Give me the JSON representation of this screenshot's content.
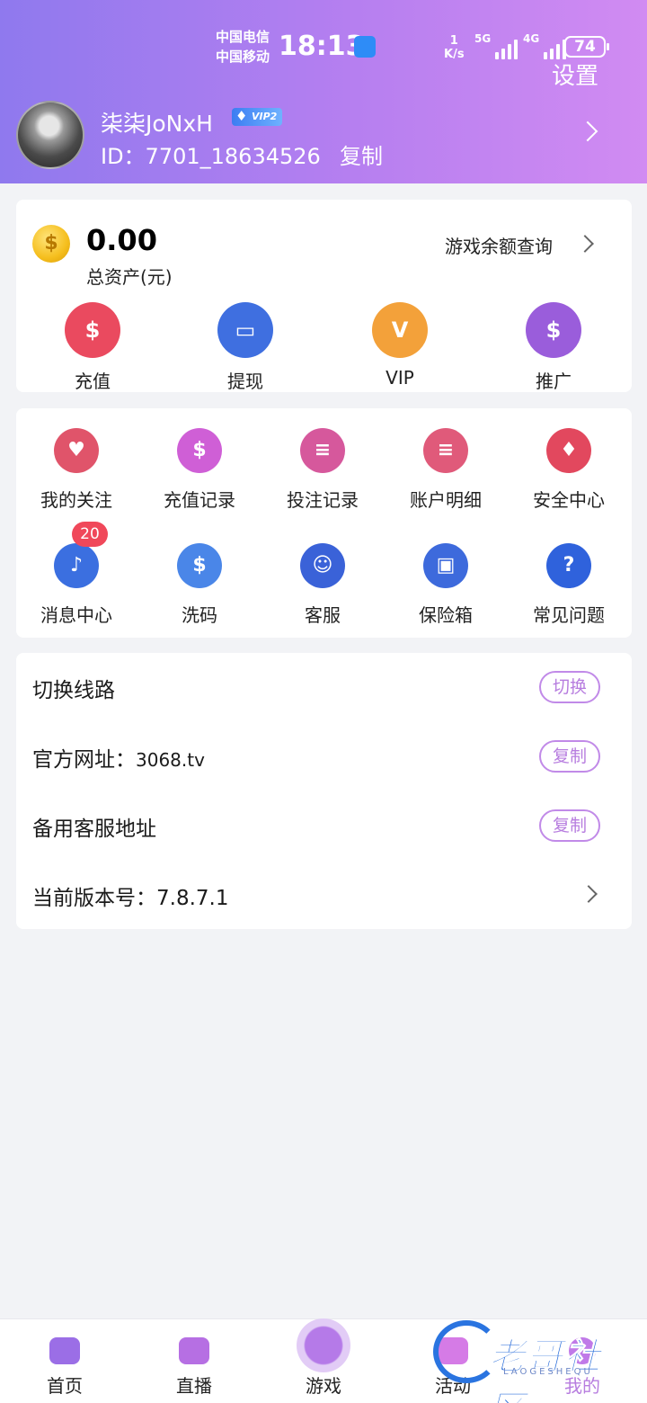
{
  "status_bar": {
    "carrier_1": "中国电信",
    "carrier_2": "中国移动",
    "time": "18:13",
    "speed_value": "1",
    "speed_unit": "K/s",
    "network_1": "5G",
    "network_2": "4G",
    "battery": "74"
  },
  "header": {
    "settings_label": "设置",
    "username": "柒柒JoNxH",
    "vip_level": "VIP2",
    "user_id": "ID：7701_18634526",
    "copy_label": "复制"
  },
  "assets": {
    "balance": "0.00",
    "label": "总资产(元)",
    "query_label": "游戏余额查询",
    "coin_symbol": "$",
    "actions": [
      {
        "label": "充值",
        "icon": "money-bag-icon",
        "glyph": "$",
        "color": "#ea4a5f"
      },
      {
        "label": "提现",
        "icon": "card-icon",
        "glyph": "▭",
        "color": "#3f6fe0"
      },
      {
        "label": "VIP",
        "icon": "vip-diamond-icon",
        "glyph": "V",
        "color": "#f3a13a"
      },
      {
        "label": "推广",
        "icon": "money-bag-plus-icon",
        "glyph": "$",
        "color": "#9a5ddb"
      }
    ]
  },
  "menu": {
    "items": [
      {
        "label": "我的关注",
        "icon": "heart-plus-icon",
        "glyph": "♥",
        "color": "#e0546a"
      },
      {
        "label": "充值记录",
        "icon": "recharge-record-icon",
        "glyph": "$",
        "color": "#cf5fd6"
      },
      {
        "label": "投注记录",
        "icon": "bet-record-icon",
        "glyph": "≡",
        "color": "#d6589c"
      },
      {
        "label": "账户明细",
        "icon": "account-detail-icon",
        "glyph": "≡",
        "color": "#e05a7a"
      },
      {
        "label": "安全中心",
        "icon": "security-lock-icon",
        "glyph": "♦",
        "color": "#e2485e"
      },
      {
        "label": "消息中心",
        "icon": "bell-icon",
        "glyph": "♪",
        "color": "#3b6fe0"
      },
      {
        "label": "洗码",
        "icon": "chip-icon",
        "glyph": "$",
        "color": "#4a86e8"
      },
      {
        "label": "客服",
        "icon": "headset-icon",
        "glyph": "☺",
        "color": "#3a62d8"
      },
      {
        "label": "保险箱",
        "icon": "safe-icon",
        "glyph": "▣",
        "color": "#3d6adc"
      },
      {
        "label": "常见问题",
        "icon": "question-icon",
        "glyph": "?",
        "color": "#2f62dc"
      }
    ],
    "message_badge": "20"
  },
  "settings": {
    "switch_line_label": "切换线路",
    "switch_button": "切换",
    "official_site_label": "官方网址：",
    "official_site_value": "3068.tv",
    "copy_button": "复制",
    "backup_service_label": "备用客服地址",
    "backup_copy_button": "复制",
    "version_label": "当前版本号：7.8.7.1"
  },
  "tabbar": {
    "tabs": [
      {
        "label": "首页",
        "icon": "home-icon",
        "color": "#9b6ee6"
      },
      {
        "label": "直播",
        "icon": "video-icon",
        "color": "#b66fe3"
      },
      {
        "label": "游戏",
        "icon": "gamepad-icon",
        "color": "#ffffff"
      },
      {
        "label": "活动",
        "icon": "activity-icon",
        "color": "#d57be6"
      },
      {
        "label": "我的",
        "icon": "profile-icon",
        "color": "#c07ae8"
      }
    ]
  },
  "watermark": {
    "text": "老哥社区",
    "sub": "LAOGESHEQU"
  }
}
